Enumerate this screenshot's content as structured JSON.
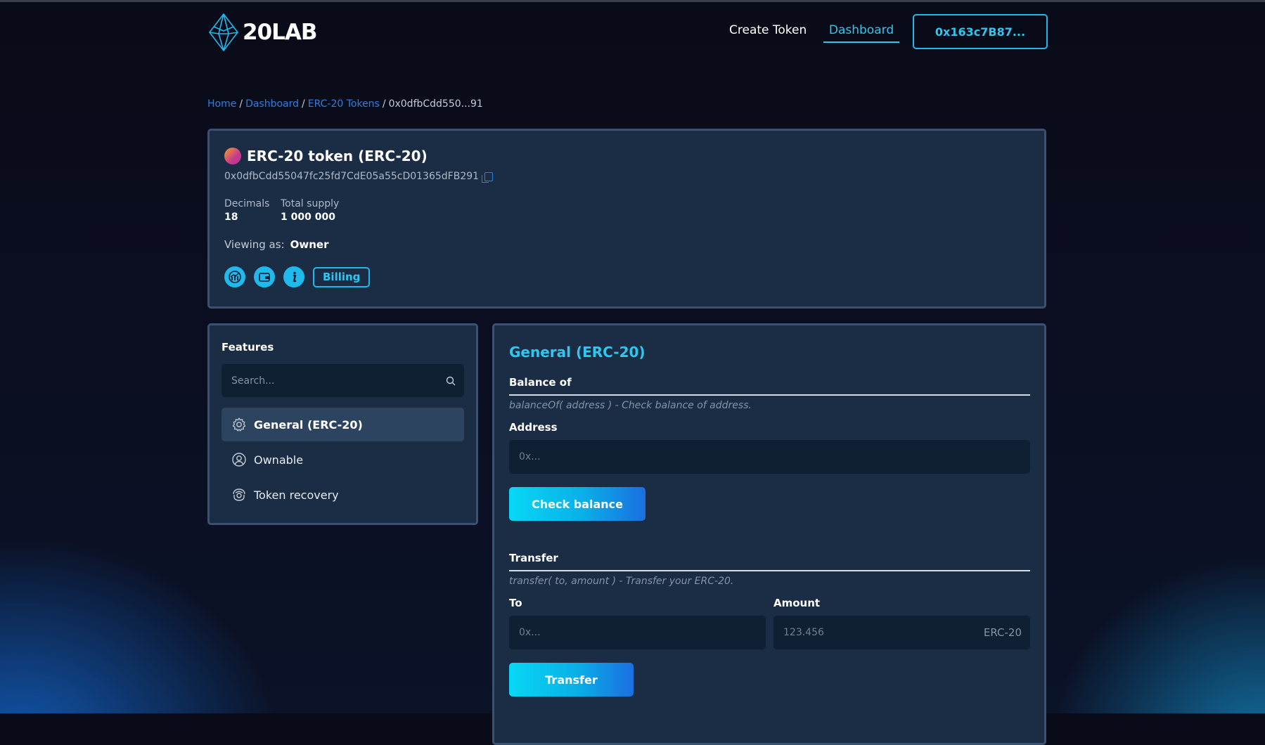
{
  "header": {
    "logo_text": "20LAB",
    "nav": {
      "create_token": "Create Token",
      "dashboard": "Dashboard"
    },
    "wallet_button": "0x163c7B87..."
  },
  "breadcrumb": {
    "home": "Home",
    "dashboard": "Dashboard",
    "tokens": "ERC-20 Tokens",
    "current": "0x0dfbCdd550...91",
    "separator": "/"
  },
  "token": {
    "name": "ERC-20 token (ERC-20)",
    "address": "0x0dfbCdd55047fc25fd7CdE05a55cD01365dFB291",
    "decimals_label": "Decimals",
    "decimals_value": "18",
    "supply_label": "Total supply",
    "supply_value": "1 000 000",
    "viewing_label": "Viewing as:",
    "viewing_role": "Owner",
    "billing_button": "Billing",
    "icons": [
      "chart-icon",
      "wallet-icon",
      "info-icon"
    ]
  },
  "features": {
    "title": "Features",
    "search_placeholder": "Search...",
    "items": [
      {
        "label": "General (ERC-20)",
        "icon": "gear-icon",
        "active": true
      },
      {
        "label": "Ownable",
        "icon": "user-circle-icon",
        "active": false
      },
      {
        "label": "Token recovery",
        "icon": "recovery-icon",
        "active": false
      }
    ]
  },
  "general": {
    "title": "General (ERC-20)",
    "balance": {
      "heading": "Balance of",
      "description": "balanceOf( address ) - Check balance of address.",
      "address_label": "Address",
      "address_placeholder": "0x...",
      "button": "Check balance"
    },
    "transfer": {
      "heading": "Transfer",
      "description": "transfer( to, amount ) - Transfer your ERC-20.",
      "to_label": "To",
      "to_placeholder": "0x...",
      "amount_label": "Amount",
      "amount_placeholder": "123.456",
      "amount_suffix": "ERC-20",
      "button": "Transfer"
    }
  },
  "colors": {
    "accent": "#2ec8ef",
    "link": "#2a7fe0",
    "card_bg": "#1b2d45",
    "card_border": "#3a5170",
    "page_bg": "#0a0b18"
  }
}
